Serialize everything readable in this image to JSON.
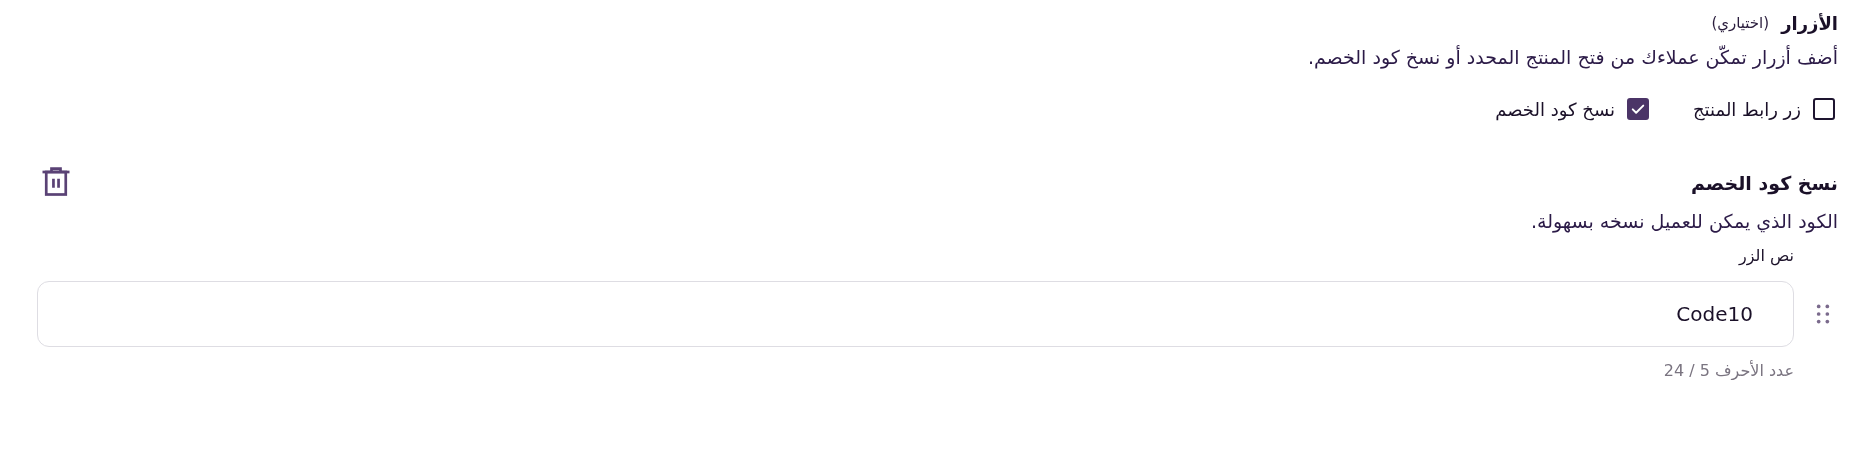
{
  "section": {
    "title": "الأزرار",
    "optional_note": "(اختياري)",
    "description": "أضف أزرار تمكّن عملاءك من فتح المنتج المحدد أو نسخ كود الخصم."
  },
  "options": [
    {
      "label": "زر رابط المنتج",
      "checked": false
    },
    {
      "label": "نسخ كود الخصم",
      "checked": true
    }
  ],
  "button_cards": [
    {
      "title": "نسخ كود الخصم",
      "description": "الكود الذي يمكن للعميل نسخه بسهولة.",
      "field_label": "نص الزر",
      "value": "Code10",
      "counter": "عدد الأحرف 5 / 24"
    }
  ]
}
